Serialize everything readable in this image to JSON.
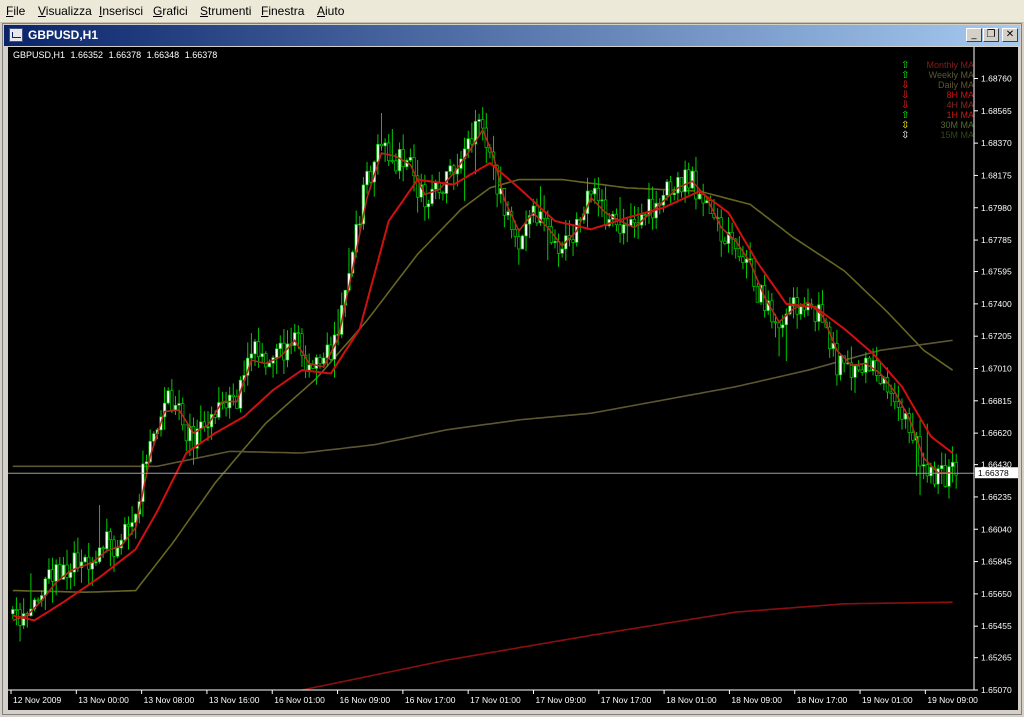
{
  "menu": [
    "File",
    "Visualizza",
    "Inserisci",
    "Grafici",
    "Strumenti",
    "Finestra",
    "Aiuto"
  ],
  "window": {
    "title": "GBPUSD,H1",
    "buttons": {
      "minimize": "_",
      "restore": "❐",
      "close": "✕"
    }
  },
  "header": {
    "symbol": "GBPUSD,H1",
    "open": "1.66352",
    "high": "1.66378",
    "low": "1.66348",
    "close": "1.66378"
  },
  "colors": {
    "background": "#000000",
    "bull_candle": "#ffffff",
    "bear_candle": "#000000",
    "wick": "#00cc00",
    "price_line": "#9aa0a8",
    "axis_text": "#ffffff",
    "ma_fast": "#b32a1c",
    "ma_red": "#d01010",
    "ma_olive": "#666622",
    "ma_khaki": "#5e5630",
    "ma_dark_red": "#8a1010"
  },
  "chart_data": {
    "type": "candlestick",
    "symbol": "GBPUSD",
    "timeframe": "H1",
    "ylim": [
      1.6507,
      1.6895
    ],
    "y_ticks": [
      "1.68760",
      "1.68565",
      "1.68370",
      "1.68175",
      "1.67980",
      "1.67785",
      "1.67595",
      "1.67400",
      "1.67205",
      "1.67010",
      "1.66815",
      "1.66620",
      "1.66430",
      "1.66235",
      "1.66040",
      "1.65845",
      "1.65650",
      "1.65455",
      "1.65265",
      "1.65070"
    ],
    "current_price": 1.66378,
    "current_price_label": "1.66378",
    "x_ticks": [
      "12 Nov 2009",
      "13 Nov 00:00",
      "13 Nov 08:00",
      "13 Nov 16:00",
      "16 Nov 01:00",
      "16 Nov 09:00",
      "16 Nov 17:00",
      "17 Nov 01:00",
      "17 Nov 09:00",
      "17 Nov 17:00",
      "18 Nov 01:00",
      "18 Nov 09:00",
      "18 Nov 17:00",
      "19 Nov 01:00",
      "19 Nov 09:00"
    ],
    "anchors": [
      [
        0,
        1.6553
      ],
      [
        4,
        1.6545
      ],
      [
        8,
        1.6568
      ],
      [
        12,
        1.6578
      ],
      [
        16,
        1.6582
      ],
      [
        22,
        1.6587
      ],
      [
        26,
        1.6596
      ],
      [
        30,
        1.6595
      ],
      [
        34,
        1.6612
      ],
      [
        38,
        1.666
      ],
      [
        42,
        1.6682
      ],
      [
        46,
        1.6675
      ],
      [
        50,
        1.6655
      ],
      [
        54,
        1.6672
      ],
      [
        58,
        1.6685
      ],
      [
        62,
        1.668
      ],
      [
        66,
        1.6715
      ],
      [
        70,
        1.6702
      ],
      [
        74,
        1.671
      ],
      [
        78,
        1.6722
      ],
      [
        82,
        1.6698
      ],
      [
        86,
        1.6702
      ],
      [
        90,
        1.6725
      ],
      [
        94,
        1.6775
      ],
      [
        98,
        1.6815
      ],
      [
        102,
        1.6838
      ],
      [
        106,
        1.6828
      ],
      [
        110,
        1.6822
      ],
      [
        114,
        1.68
      ],
      [
        118,
        1.6812
      ],
      [
        122,
        1.6822
      ],
      [
        126,
        1.6835
      ],
      [
        130,
        1.685
      ],
      [
        133,
        1.6822
      ],
      [
        136,
        1.6795
      ],
      [
        140,
        1.6778
      ],
      [
        144,
        1.68
      ],
      [
        148,
        1.6782
      ],
      [
        152,
        1.6772
      ],
      [
        156,
        1.6788
      ],
      [
        160,
        1.681
      ],
      [
        164,
        1.679
      ],
      [
        168,
        1.6788
      ],
      [
        172,
        1.6785
      ],
      [
        176,
        1.6798
      ],
      [
        180,
        1.6805
      ],
      [
        184,
        1.6812
      ],
      [
        188,
        1.6815
      ],
      [
        192,
        1.68
      ],
      [
        196,
        1.678
      ],
      [
        200,
        1.6775
      ],
      [
        204,
        1.676
      ],
      [
        208,
        1.6738
      ],
      [
        212,
        1.6725
      ],
      [
        216,
        1.674
      ],
      [
        220,
        1.6742
      ],
      [
        224,
        1.673
      ],
      [
        228,
        1.6705
      ],
      [
        232,
        1.67
      ],
      [
        236,
        1.6705
      ],
      [
        240,
        1.6695
      ],
      [
        244,
        1.6683
      ],
      [
        248,
        1.6665
      ],
      [
        252,
        1.664
      ],
      [
        256,
        1.6635
      ],
      [
        260,
        1.6638
      ]
    ],
    "moving_averages": [
      {
        "name": "1H MA",
        "type": "fast",
        "points": [
          [
            0,
            1.6549
          ],
          [
            4,
            1.6552
          ],
          [
            8,
            1.6561
          ],
          [
            12,
            1.6572
          ],
          [
            16,
            1.6579
          ],
          [
            22,
            1.6584
          ],
          [
            26,
            1.6591
          ],
          [
            30,
            1.6594
          ],
          [
            34,
            1.6605
          ],
          [
            38,
            1.6648
          ],
          [
            42,
            1.6675
          ],
          [
            46,
            1.6676
          ],
          [
            50,
            1.6662
          ],
          [
            54,
            1.6667
          ],
          [
            58,
            1.6681
          ],
          [
            62,
            1.6681
          ],
          [
            66,
            1.6706
          ],
          [
            70,
            1.6704
          ],
          [
            74,
            1.6708
          ],
          [
            78,
            1.6718
          ],
          [
            82,
            1.6704
          ],
          [
            86,
            1.6702
          ],
          [
            90,
            1.6719
          ],
          [
            94,
            1.6761
          ],
          [
            98,
            1.6804
          ],
          [
            102,
            1.6831
          ],
          [
            106,
            1.6829
          ],
          [
            110,
            1.6824
          ],
          [
            114,
            1.6806
          ],
          [
            118,
            1.6809
          ],
          [
            122,
            1.6819
          ],
          [
            126,
            1.6831
          ],
          [
            130,
            1.6845
          ],
          [
            133,
            1.6829
          ],
          [
            136,
            1.6803
          ],
          [
            140,
            1.6784
          ],
          [
            144,
            1.6795
          ],
          [
            148,
            1.6786
          ],
          [
            152,
            1.6775
          ],
          [
            156,
            1.6784
          ],
          [
            160,
            1.6804
          ],
          [
            164,
            1.6795
          ],
          [
            168,
            1.679
          ],
          [
            172,
            1.6786
          ],
          [
            176,
            1.6794
          ],
          [
            180,
            1.6802
          ],
          [
            184,
            1.681
          ],
          [
            188,
            1.6814
          ],
          [
            192,
            1.6804
          ],
          [
            196,
            1.6786
          ],
          [
            200,
            1.6778
          ],
          [
            204,
            1.6765
          ],
          [
            208,
            1.6744
          ],
          [
            212,
            1.6729
          ],
          [
            216,
            1.6737
          ],
          [
            220,
            1.6741
          ],
          [
            224,
            1.6733
          ],
          [
            228,
            1.6712
          ],
          [
            232,
            1.6703
          ],
          [
            236,
            1.6704
          ],
          [
            240,
            1.6698
          ],
          [
            244,
            1.6687
          ],
          [
            248,
            1.6671
          ],
          [
            252,
            1.6647
          ],
          [
            256,
            1.6638
          ],
          [
            260,
            1.6638
          ]
        ]
      },
      {
        "name": "4H MA",
        "type": "red",
        "points": [
          [
            0,
            1.6552
          ],
          [
            6,
            1.6549
          ],
          [
            14,
            1.656
          ],
          [
            24,
            1.6575
          ],
          [
            34,
            1.6592
          ],
          [
            40,
            1.6615
          ],
          [
            48,
            1.665
          ],
          [
            56,
            1.6662
          ],
          [
            64,
            1.6672
          ],
          [
            72,
            1.6688
          ],
          [
            80,
            1.67
          ],
          [
            88,
            1.6698
          ],
          [
            96,
            1.6725
          ],
          [
            104,
            1.679
          ],
          [
            112,
            1.6815
          ],
          [
            122,
            1.6812
          ],
          [
            132,
            1.6825
          ],
          [
            140,
            1.681
          ],
          [
            150,
            1.679
          ],
          [
            160,
            1.6785
          ],
          [
            170,
            1.6792
          ],
          [
            180,
            1.6798
          ],
          [
            190,
            1.6808
          ],
          [
            198,
            1.6795
          ],
          [
            206,
            1.6765
          ],
          [
            214,
            1.674
          ],
          [
            222,
            1.6738
          ],
          [
            230,
            1.6725
          ],
          [
            238,
            1.671
          ],
          [
            246,
            1.669
          ],
          [
            254,
            1.666
          ],
          [
            260,
            1.665
          ]
        ]
      },
      {
        "name": "8H MA",
        "type": "olive",
        "points": [
          [
            0,
            1.6567
          ],
          [
            20,
            1.6566
          ],
          [
            34,
            1.6567
          ],
          [
            44,
            1.6595
          ],
          [
            56,
            1.6632
          ],
          [
            70,
            1.6668
          ],
          [
            84,
            1.6695
          ],
          [
            98,
            1.673
          ],
          [
            112,
            1.677
          ],
          [
            124,
            1.6797
          ],
          [
            132,
            1.681
          ],
          [
            140,
            1.6815
          ],
          [
            152,
            1.6815
          ],
          [
            170,
            1.681
          ],
          [
            190,
            1.6808
          ],
          [
            204,
            1.68
          ],
          [
            216,
            1.678
          ],
          [
            230,
            1.676
          ],
          [
            242,
            1.6735
          ],
          [
            252,
            1.6712
          ],
          [
            260,
            1.67
          ]
        ]
      },
      {
        "name": "Daily MA",
        "type": "khaki",
        "points": [
          [
            0,
            1.6642
          ],
          [
            40,
            1.6642
          ],
          [
            60,
            1.6651
          ],
          [
            80,
            1.665
          ],
          [
            100,
            1.6655
          ],
          [
            120,
            1.6664
          ],
          [
            140,
            1.667
          ],
          [
            160,
            1.6674
          ],
          [
            180,
            1.6682
          ],
          [
            200,
            1.669
          ],
          [
            220,
            1.67
          ],
          [
            240,
            1.6712
          ],
          [
            260,
            1.6718
          ]
        ]
      },
      {
        "name": "Weekly MA",
        "type": "dark_red",
        "points": [
          [
            80,
            1.6507
          ],
          [
            120,
            1.6525
          ],
          [
            160,
            1.654
          ],
          [
            200,
            1.6554
          ],
          [
            230,
            1.6559
          ],
          [
            260,
            1.656
          ]
        ]
      }
    ]
  },
  "legend": [
    {
      "arrow": "⇧",
      "label": "Monthly MA",
      "arrow_color": "#00ff00",
      "label_color": "#8b1a1a"
    },
    {
      "arrow": "⇧",
      "label": "Weekly MA",
      "arrow_color": "#00ff00",
      "label_color": "#5a5a30"
    },
    {
      "arrow": "⇩",
      "label": "Daily MA",
      "arrow_color": "#ff2222",
      "label_color": "#5e5630"
    },
    {
      "arrow": "⇩",
      "label": "8H MA",
      "arrow_color": "#ff2222",
      "label_color": "#cc1010"
    },
    {
      "arrow": "⇩",
      "label": "4H MA",
      "arrow_color": "#ff2222",
      "label_color": "#8a2a1a"
    },
    {
      "arrow": "⇧",
      "label": "1H MA",
      "arrow_color": "#00ff00",
      "label_color": "#cc1a10"
    },
    {
      "arrow": "⇳",
      "label": "30M MA",
      "arrow_color": "#ffff00",
      "label_color": "#556b2f"
    },
    {
      "arrow": "⇳",
      "label": "15M MA",
      "arrow_color": "#ffffff",
      "label_color": "#2d4a12"
    }
  ]
}
